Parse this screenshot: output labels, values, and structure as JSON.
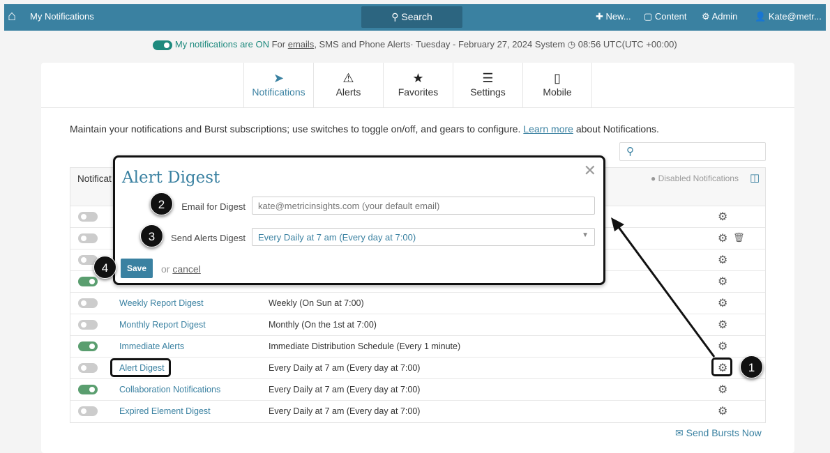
{
  "topbar": {
    "title": "My Notifications",
    "search": "Search",
    "new": "New...",
    "content": "Content",
    "admin": "Admin",
    "user": "Kate@metr..."
  },
  "status": {
    "on_text": "My notifications are ON",
    "for": "For",
    "emails": "emails",
    "rest": ", SMS and Phone Alerts· Tuesday - February 27, 2024 System",
    "time": "08:56 UTC(UTC +00:00)"
  },
  "tabs": [
    {
      "label": "Notifications",
      "icon": "paper-plane-icon"
    },
    {
      "label": "Alerts",
      "icon": "warning-icon"
    },
    {
      "label": "Favorites",
      "icon": "star-icon"
    },
    {
      "label": "Settings",
      "icon": "sliders-icon"
    },
    {
      "label": "Mobile",
      "icon": "mobile-icon"
    }
  ],
  "intro": {
    "text": "Maintain your notifications and Burst subscriptions; use switches to toggle on/off, and gears to configure.",
    "link": "Learn more",
    "after": "about Notifications."
  },
  "table": {
    "header": "Notificat",
    "disabled": "Disabled Notifications",
    "rows": [
      {
        "on": false,
        "name": "",
        "schedule": "",
        "trash": false
      },
      {
        "on": false,
        "name": "",
        "schedule": "",
        "trash": true
      },
      {
        "on": false,
        "name": "",
        "schedule": "",
        "trash": false
      },
      {
        "on": true,
        "name": "",
        "schedule": "",
        "trash": false
      },
      {
        "on": false,
        "name": "Weekly Report Digest",
        "schedule": "Weekly (On Sun at 7:00)"
      },
      {
        "on": false,
        "name": "Monthly Report Digest",
        "schedule": "Monthly (On the 1st at 7:00)"
      },
      {
        "on": true,
        "name": "Immediate Alerts",
        "schedule": "Immediate Distribution Schedule (Every 1 minute)"
      },
      {
        "on": false,
        "name": "Alert Digest",
        "schedule": "Every Daily at 7 am (Every day at 7:00)"
      },
      {
        "on": true,
        "name": "Collaboration Notifications",
        "schedule": "Every Daily at 7 am (Every day at 7:00)"
      },
      {
        "on": false,
        "name": "Expired Element Digest",
        "schedule": "Every Daily at 7 am (Every day at 7:00)"
      }
    ]
  },
  "send_bursts": "Send Bursts Now",
  "modal": {
    "title": "Alert Digest",
    "email_label": "Email for Digest",
    "email_placeholder": "kate@metricinsights.com (your default email)",
    "send_label": "Send Alerts Digest",
    "send_value": "Every Daily at 7 am (Every day at 7:00)",
    "save": "Save",
    "or": "or",
    "cancel": "cancel"
  },
  "badges": [
    "1",
    "2",
    "3",
    "4"
  ]
}
